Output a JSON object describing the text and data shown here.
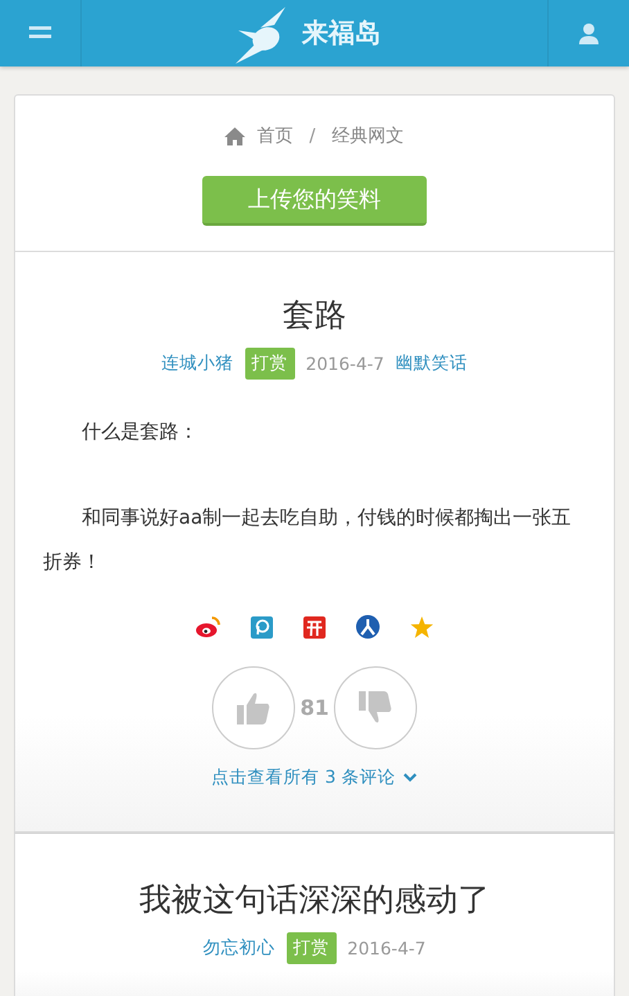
{
  "header": {
    "site_name": "来福岛"
  },
  "breadcrumb": {
    "items": [
      "首页",
      "经典网文"
    ],
    "separator": "/"
  },
  "upload_button": "上传您的笑料",
  "posts": [
    {
      "title": "套路",
      "author": "连城小猪",
      "tip": "打赏",
      "date": "2016-4-7",
      "category": "幽默笑话",
      "paragraphs": [
        "什么是套路：",
        "和同事说好aa制一起去吃自助，付钱的时候都掏出一张五折券！"
      ],
      "likes": "81",
      "comments_link": "点击查看所有 3 条评论"
    },
    {
      "title": "我被这句话深深的感动了",
      "author": "勿忘初心",
      "tip": "打赏",
      "date": "2016-4-7"
    }
  ]
}
